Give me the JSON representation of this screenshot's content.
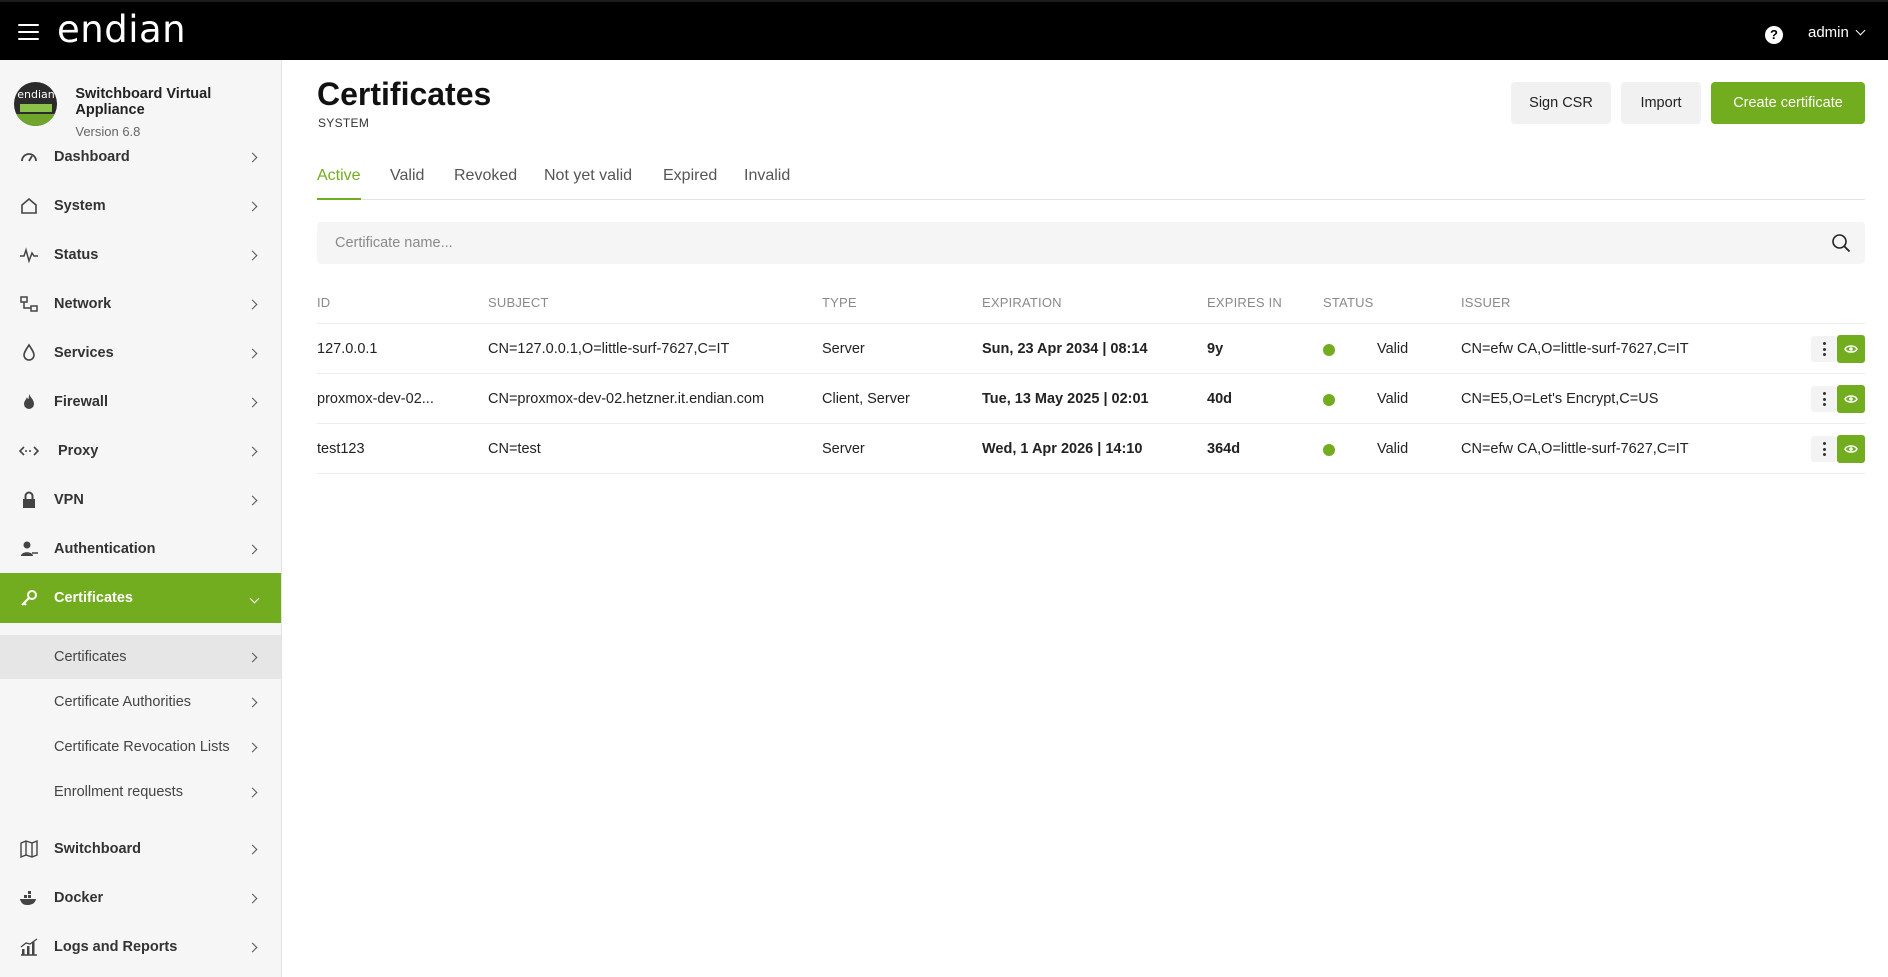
{
  "topbar": {
    "logo": "endian",
    "help_glyph": "?",
    "user": "admin",
    "icons": [
      "hamburger-icon",
      "help-icon",
      "chevron-down-icon"
    ]
  },
  "sidebar": {
    "appliance_name": "Switchboard Virtual Appliance",
    "appliance_version": "Version 6.8",
    "avatar_text": "endian",
    "items": [
      {
        "label": "Dashboard",
        "icon": "gauge-icon"
      },
      {
        "label": "System",
        "icon": "home-icon"
      },
      {
        "label": "Status",
        "icon": "pulse-icon"
      },
      {
        "label": "Network",
        "icon": "network-icon"
      },
      {
        "label": "Services",
        "icon": "drop-icon"
      },
      {
        "label": "Firewall",
        "icon": "flame-icon"
      },
      {
        "label": "Proxy",
        "icon": "arrows-icon"
      },
      {
        "label": "VPN",
        "icon": "lock-icon"
      },
      {
        "label": "Authentication",
        "icon": "user-key-icon"
      },
      {
        "label": "Certificates",
        "icon": "key-icon"
      },
      {
        "label": "Switchboard",
        "icon": "map-icon"
      },
      {
        "label": "Docker",
        "icon": "docker-icon"
      },
      {
        "label": "Logs and Reports",
        "icon": "chart-icon"
      }
    ],
    "subitems": [
      {
        "label": "Certificates"
      },
      {
        "label": "Certificate Authorities"
      },
      {
        "label": "Certificate Revocation Lists"
      },
      {
        "label": "Enrollment requests"
      }
    ]
  },
  "page": {
    "title": "Certificates",
    "subtitle": "SYSTEM",
    "buttons": {
      "sign_csr": "Sign CSR",
      "import": "Import",
      "create": "Create certificate"
    },
    "tabs": [
      "Active",
      "Valid",
      "Revoked",
      "Not yet valid",
      "Expired",
      "Invalid"
    ],
    "active_tab": "Active",
    "search_placeholder": "Certificate name..."
  },
  "table": {
    "columns": [
      "ID",
      "SUBJECT",
      "TYPE",
      "EXPIRATION",
      "EXPIRES IN",
      "STATUS",
      "ISSUER"
    ],
    "rows": [
      {
        "id": "127.0.0.1",
        "subject": "CN=127.0.0.1,O=little-surf-7627,C=IT",
        "type": "Server",
        "expiration": "Sun, 23 Apr 2034 | 08:14",
        "expires_in": "9y",
        "status": "Valid",
        "issuer": "CN=efw CA,O=little-surf-7627,C=IT"
      },
      {
        "id": "proxmox-dev-02...",
        "subject": "CN=proxmox-dev-02.hetzner.it.endian.com",
        "type": "Client, Server",
        "expiration": "Tue, 13 May 2025 | 02:01",
        "expires_in": "40d",
        "status": "Valid",
        "issuer": "CN=E5,O=Let's Encrypt,C=US"
      },
      {
        "id": "test123",
        "subject": "CN=test",
        "type": "Server",
        "expiration": "Wed, 1 Apr 2026 | 14:10",
        "expires_in": "364d",
        "status": "Valid",
        "issuer": "CN=efw CA,O=little-surf-7627,C=IT"
      }
    ]
  },
  "colors": {
    "accent": "#72ad1f",
    "topbar": "#000000",
    "sidebar": "#f6f6f6"
  }
}
